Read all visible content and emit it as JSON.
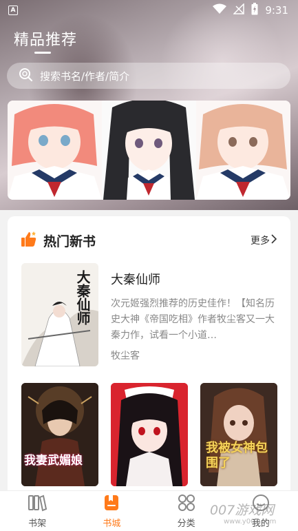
{
  "status_bar": {
    "time": "9:31",
    "notif_letter": "A"
  },
  "header": {
    "title": "精品推荐"
  },
  "search": {
    "placeholder": "搜索书名/作者/简介"
  },
  "section": {
    "title": "热门新书",
    "more_label": "更多"
  },
  "featured_book": {
    "title": "大秦仙师",
    "description": "次元姬强烈推荐的历史佳作！【知名历史大神《帝国吃相》作者牧尘客又一大秦力作，试看一个小道…",
    "author": "牧尘客",
    "cover_text": "大秦仙师"
  },
  "grid_books": [
    {
      "cover_text": "我妻武媚娘"
    },
    {
      "cover_text": ""
    },
    {
      "cover_text": "我被女神包围了"
    }
  ],
  "tabs": [
    {
      "label": "书架",
      "icon": "bookshelf-icon"
    },
    {
      "label": "书城",
      "icon": "bookstore-icon"
    },
    {
      "label": "分类",
      "icon": "category-icon"
    },
    {
      "label": "我的",
      "icon": "profile-icon"
    }
  ],
  "watermark": {
    "text": "007游戏网",
    "sub": "www.y007.com"
  },
  "colors": {
    "accent": "#ff7a1a",
    "title_text": "#222222",
    "muted_text": "#888888"
  }
}
